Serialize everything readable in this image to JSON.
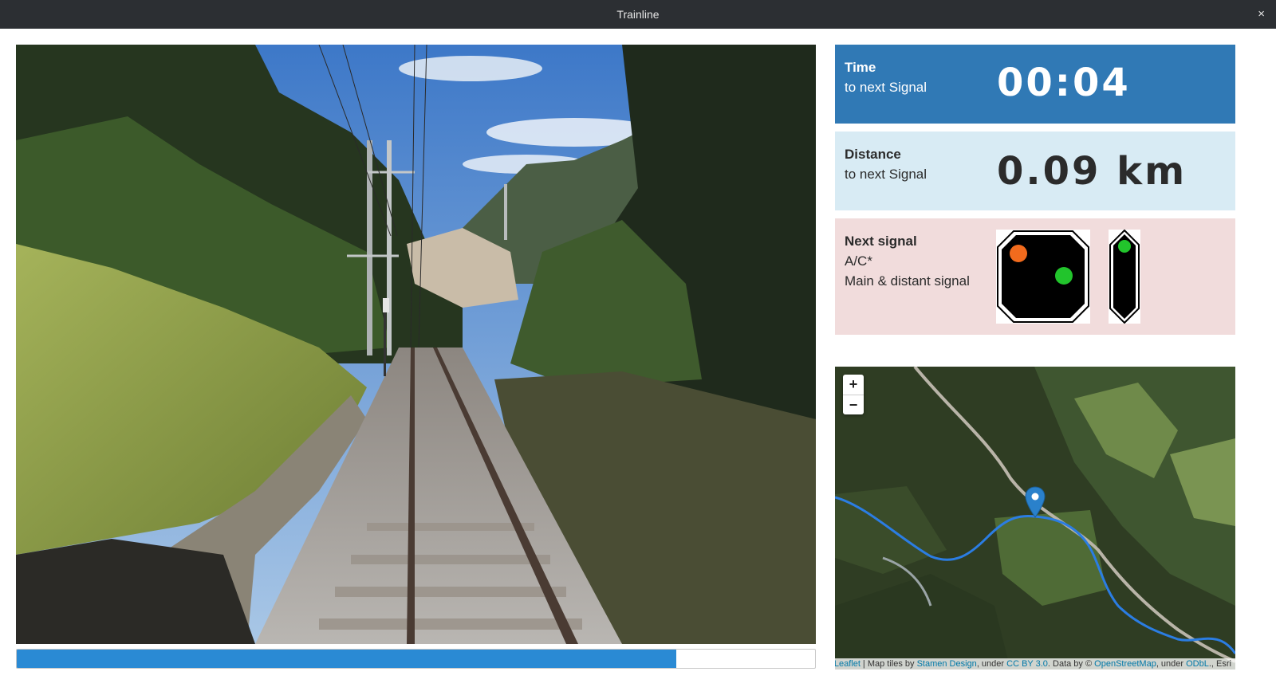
{
  "window": {
    "title": "Trainline",
    "close_glyph": "×"
  },
  "video": {
    "progress_fraction": 0.826
  },
  "time_panel": {
    "title": "Time",
    "subtitle": "to next Signal",
    "value": "00:04"
  },
  "distance_panel": {
    "title": "Distance",
    "subtitle": "to next Signal",
    "value": "0.09 km"
  },
  "signal_panel": {
    "title": "Next signal",
    "code": "A/C*",
    "type": "Main & distant signal",
    "colors": {
      "orange": "#f26b1d",
      "green": "#22c42c",
      "housing": "#000000"
    }
  },
  "map": {
    "zoom_in": "+",
    "zoom_out": "−",
    "route_color": "#2b7de3",
    "attribution": {
      "leaflet": "Leaflet",
      "sep1": " | Map tiles by ",
      "stamen": "Stamen Design",
      "sep2": ", under ",
      "ccby": "CC BY 3.0",
      "sep3": ". Data by © ",
      "osm": "OpenStreetMap",
      "sep4": ", under ",
      "odbl": "ODbL",
      "sep5": "., Esri"
    }
  },
  "colors": {
    "time_bg": "#3079b5",
    "distance_bg": "#d8ebf4",
    "signal_bg": "#f1dcdc",
    "progress": "#2a8ad4"
  }
}
